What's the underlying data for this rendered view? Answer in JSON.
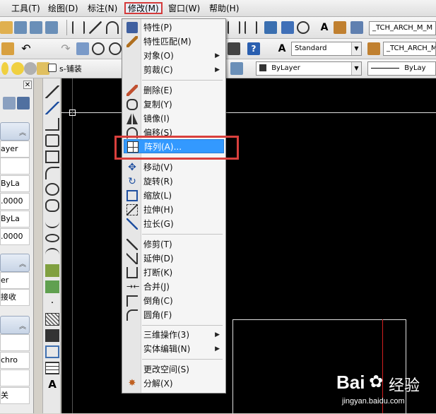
{
  "menubar": {
    "items": [
      "工具(T)",
      "绘图(D)",
      "标注(N)",
      "修改(M)",
      "窗口(W)",
      "帮助(H)"
    ]
  },
  "toolbars": {
    "text_style": "Standard",
    "dim_style_1": "_TCH_ARCH_M_M",
    "dim_style_2": "_TCH_ARCH_M_",
    "layer_name": "s-铺装",
    "color": "ByLayer",
    "linetype": "ByLay"
  },
  "left_panel": {
    "cells": [
      "ayer",
      "ByLa",
      ".0000",
      "ByLa",
      ".0000",
      "er",
      "接收",
      "chro",
      "关"
    ]
  },
  "modify_menu": {
    "items": [
      {
        "label": "特性(P)",
        "icon": "properties-icon"
      },
      {
        "label": "特性匹配(M)",
        "icon": "match-properties-icon"
      },
      {
        "label": "对象(O)",
        "submenu": true
      },
      {
        "label": "剪裁(C)",
        "submenu": true
      },
      {
        "label": "删除(E)",
        "icon": "erase-icon"
      },
      {
        "label": "复制(Y)",
        "icon": "copy-icon"
      },
      {
        "label": "镜像(I)",
        "icon": "mirror-icon"
      },
      {
        "label": "偏移(S)",
        "icon": "offset-icon"
      },
      {
        "label": "阵列(A)...",
        "icon": "array-icon",
        "highlighted": true
      },
      {
        "label": "移动(V)",
        "icon": "move-icon"
      },
      {
        "label": "旋转(R)",
        "icon": "rotate-icon"
      },
      {
        "label": "缩放(L)",
        "icon": "scale-icon"
      },
      {
        "label": "拉伸(H)",
        "icon": "stretch-icon"
      },
      {
        "label": "拉长(G)",
        "icon": "lengthen-icon"
      },
      {
        "label": "修剪(T)",
        "icon": "trim-icon"
      },
      {
        "label": "延伸(D)",
        "icon": "extend-icon"
      },
      {
        "label": "打断(K)",
        "icon": "break-icon"
      },
      {
        "label": "合并(J)",
        "icon": "join-icon"
      },
      {
        "label": "倒角(C)",
        "icon": "chamfer-icon"
      },
      {
        "label": "圆角(F)",
        "icon": "fillet-icon"
      },
      {
        "label": "三维操作(3)",
        "submenu": true
      },
      {
        "label": "实体编辑(N)",
        "submenu": true
      },
      {
        "label": "更改空间(S)"
      },
      {
        "label": "分解(X)",
        "icon": "explode-icon"
      }
    ]
  },
  "watermark": {
    "brand": "Bai",
    "brand2": "经验",
    "url": "jingyan.baidu.com"
  },
  "colors": {
    "highlight": "#3399ff",
    "annotation_red": "#d9403d",
    "canvas": "#000000"
  }
}
